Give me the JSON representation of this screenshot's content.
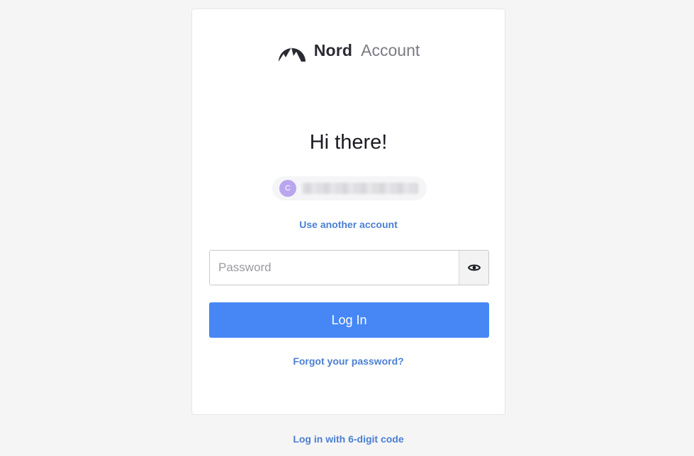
{
  "header": {
    "brand": "Nord",
    "product": "Account",
    "logo_icon": "nord-mountain-logo-icon"
  },
  "greeting": {
    "title": "Hi there!"
  },
  "account_chip": {
    "avatar_initial": "C",
    "avatar_color": "#b9a6ef"
  },
  "links": {
    "use_another_account": "Use another account",
    "forgot_password": "Forgot your password?",
    "six_digit_code": "Log in with 6-digit code"
  },
  "password": {
    "value": "",
    "placeholder": "Password",
    "toggle_icon": "eye-icon"
  },
  "login_button": {
    "label": "Log In",
    "color": "#4687f5"
  },
  "colors": {
    "link": "#4b7fd3",
    "background": "#f5f5f5"
  }
}
